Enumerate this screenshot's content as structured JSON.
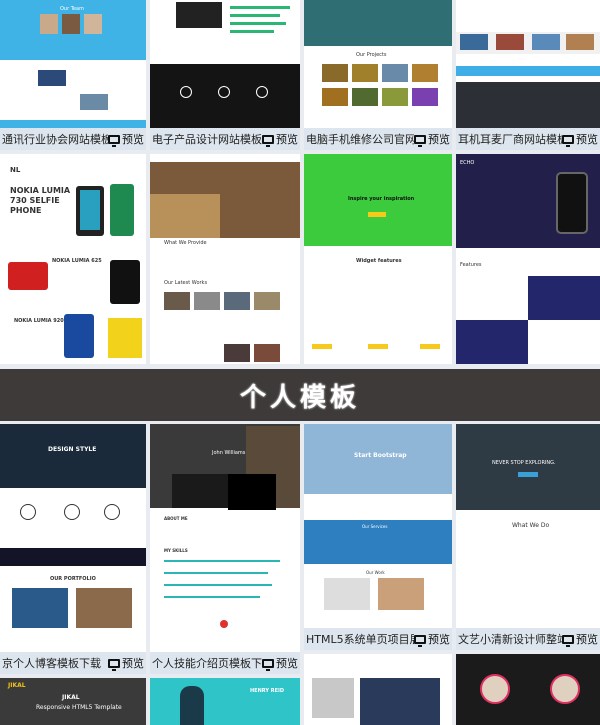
{
  "banner_title": "个人模板",
  "preview_label": "预览",
  "cards": [
    {
      "title": "通讯行业协会网站模板",
      "thumb_lines": [
        "Our Team"
      ]
    },
    {
      "title": "电子产品设计网站模板",
      "thumb_lines": []
    },
    {
      "title": "电脑手机维修公司官网",
      "thumb_lines": [
        "Our Projects"
      ]
    },
    {
      "title": "耳机耳麦厂商网站模板",
      "thumb_lines": []
    },
    {
      "title": "",
      "thumb_lines": [
        "NL",
        "NOKIA LUMIA",
        "730 SELFIE",
        "PHONE",
        "NOKIA LUMIA 625",
        "NOKIA LUMIA 920"
      ]
    },
    {
      "title": "",
      "thumb_lines": [
        "What We Provide",
        "Our Latest Works"
      ]
    },
    {
      "title": "",
      "thumb_lines": [
        "Inspire your inspiration",
        "Widget features"
      ]
    },
    {
      "title": "",
      "thumb_lines": [
        "ECHO",
        "Features"
      ]
    },
    {
      "title": "个人博客模板下载",
      "title_prefix": "京",
      "thumb_lines": [
        "DESIGN STYLE",
        "OUR PORTFOLIO"
      ]
    },
    {
      "title": "个人技能介绍页模板下",
      "thumb_lines": [
        "John Williams",
        "ABOUT ME",
        "MY SKILLS"
      ]
    },
    {
      "title": "HTML5系统单页项目展",
      "thumb_lines": [
        "Start Bootstrap",
        "Our Services",
        "Our Work"
      ]
    },
    {
      "title": "文艺小清新设计师整站",
      "thumb_lines": [
        "NEVER STOP EXPLORING.",
        "What We Do"
      ]
    },
    {
      "title": "",
      "thumb_lines": [
        "JIKAL",
        "Responsive HTML5 Template"
      ]
    },
    {
      "title": "",
      "thumb_lines": [
        "HENRY REID"
      ]
    },
    {
      "title": "",
      "thumb_lines": []
    },
    {
      "title": "",
      "thumb_lines": []
    }
  ]
}
